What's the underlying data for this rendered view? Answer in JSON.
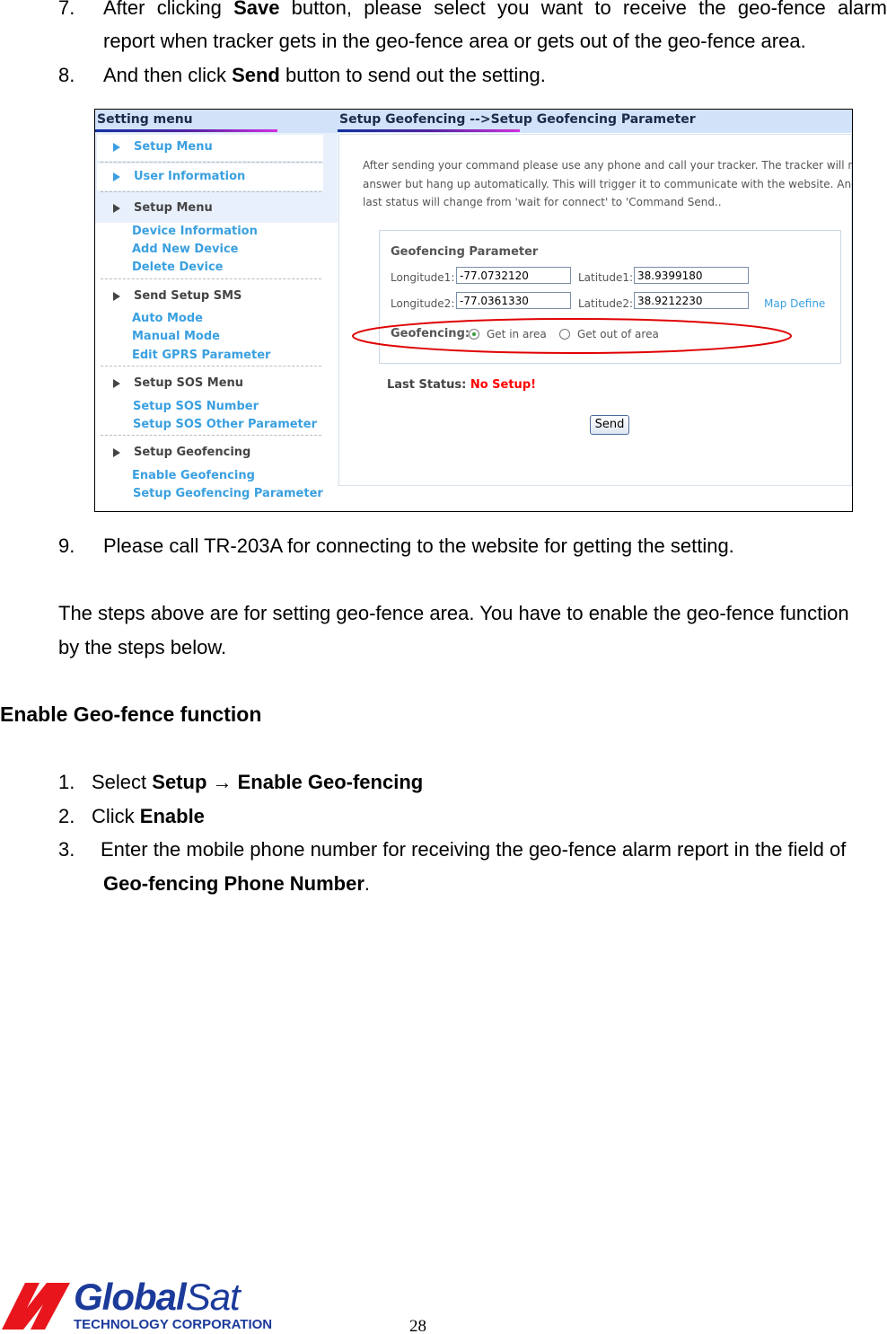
{
  "steps_top": [
    {
      "num": "7.",
      "line1_pre": "After clicking ",
      "line1_bold": "Save",
      "line1_post": " button, please select you want to receive the geo-fence alarm",
      "line2": "report when tracker gets in the geo-fence area or gets out of the geo-fence area."
    },
    {
      "num": "8.",
      "pre": "And then click ",
      "bold": "Send",
      "post": " button to send out the setting."
    }
  ],
  "screenshot": {
    "menu_title": "Setting menu",
    "panel_title": "Setup Geofencing -->Setup Geofencing Parameter",
    "menu": {
      "top_items": [
        "Setup Menu",
        "User Information"
      ],
      "groups": [
        {
          "title": "Setup Menu",
          "items": [
            "Device Information",
            "Add New Device",
            "Delete Device"
          ]
        },
        {
          "title": "Send Setup SMS",
          "items": [
            "Auto Mode",
            "Manual Mode",
            "Edit GPRS Parameter"
          ]
        },
        {
          "title": "Setup SOS Menu",
          "items": [
            "Setup SOS Number",
            "Setup SOS Other Parameter"
          ]
        },
        {
          "title": "Setup Geofencing",
          "items": [
            "Enable Geofencing",
            "Setup Geofencing Parameter"
          ]
        }
      ]
    },
    "info_lines": [
      "After sending your command please use any phone and call your tracker. The tracker will not",
      "answer but hang up automatically. This will trigger it to communicate with the website. And",
      "last status will change from 'wait for connect' to 'Command Send.."
    ],
    "form": {
      "title": "Geofencing Parameter",
      "longitude1_label": "Longitude1:",
      "longitude1": "-77.0732120",
      "latitude1_label": "Latitude1:",
      "latitude1": "38.9399180",
      "longitude2_label": "Longitude2:",
      "longitude2": "-77.0361330",
      "latitude2_label": "Latitude2:",
      "latitude2": "38.9212230",
      "map_define": "Map Define",
      "geofencing_label": "Geofencing:",
      "option_in": "Get in area",
      "option_out": "Get out of area",
      "selected": "Get in area"
    },
    "last_status_label": "Last Status:",
    "last_status_value": "No Setup!",
    "send_label": "Send",
    "colors": {
      "link": "#3aa0e0",
      "status": "#ff0000",
      "highlight_ellipse": "#e00000",
      "header": "#d2e2f8"
    }
  },
  "step9": {
    "num": "9.",
    "text": "Please call TR-203A for connecting to the website for getting the setting."
  },
  "para": {
    "line1": "The steps above are for setting geo-fence area. You have to enable the geo-fence function",
    "line2": "by the steps below."
  },
  "section_title": "Enable Geo-fence function",
  "steps_bottom": [
    {
      "num": "1.",
      "pre": "Select ",
      "b1": "Setup",
      "arrow": " → ",
      "b2": "Enable Geo-fencing"
    },
    {
      "num": "2.",
      "pre": "Click ",
      "b1": "Enable"
    },
    {
      "num": "3.",
      "line1": "Enter the mobile phone number for receiving the geo-fence alarm report in the field of",
      "line2_bold": "Geo-fencing Phone Number",
      "line2_post": "."
    }
  ],
  "footer": {
    "logo_main": "GlobalSat",
    "logo_sub": "TECHNOLOGY CORPORATION",
    "page_number": "28"
  }
}
